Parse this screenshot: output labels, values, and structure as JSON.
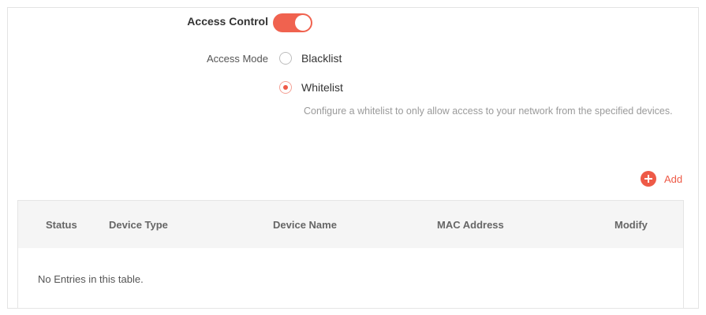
{
  "access_control": {
    "label": "Access Control",
    "enabled": true
  },
  "access_mode": {
    "label": "Access Mode",
    "options": [
      {
        "label": "Blacklist",
        "selected": false
      },
      {
        "label": "Whitelist",
        "selected": true
      }
    ],
    "description": "Configure a whitelist to only allow access to your network from the specified devices."
  },
  "add_button": {
    "label": "Add",
    "icon": "plus-circle-icon"
  },
  "table": {
    "columns": [
      "Status",
      "Device Type",
      "Device Name",
      "MAC Address",
      "Modify"
    ],
    "empty_message": "No Entries in this table."
  },
  "colors": {
    "accent": "#ee5a47",
    "header_bg": "#f5f5f5"
  }
}
